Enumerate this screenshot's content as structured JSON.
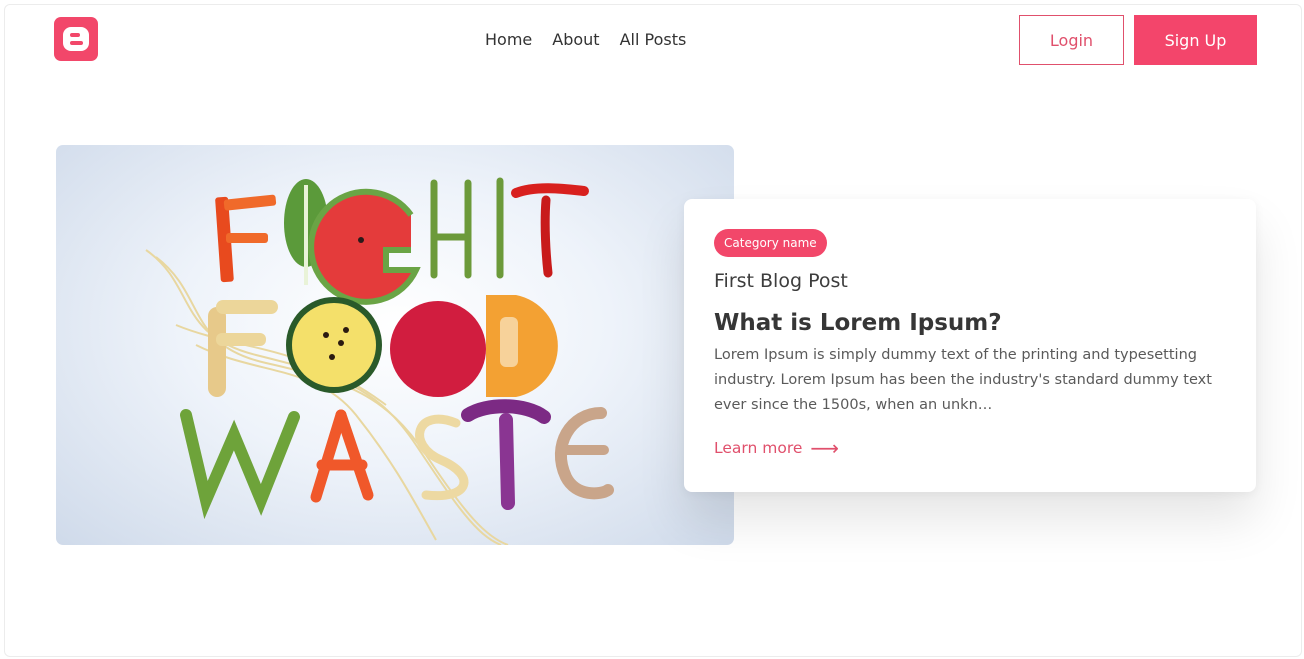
{
  "header": {
    "logo_icon": "blogger-icon",
    "brand_color": "#f2476a",
    "nav": [
      "Home",
      "About",
      "All Posts"
    ],
    "login_label": "Login",
    "signup_label": "Sign Up"
  },
  "featured": {
    "image_text": [
      "FIGHT",
      "FOOD",
      "WASTE"
    ],
    "category": "Category name",
    "post_label": "First Blog Post",
    "title": "What is Lorem Ipsum?",
    "excerpt": "Lorem Ipsum is simply dummy text of the printing and typesetting industry. Lorem Ipsum has been the industry's standard dummy text ever since the 1500s, when an unkn…",
    "learn_more": "Learn more",
    "arrow_icon": "arrow-right-icon"
  }
}
